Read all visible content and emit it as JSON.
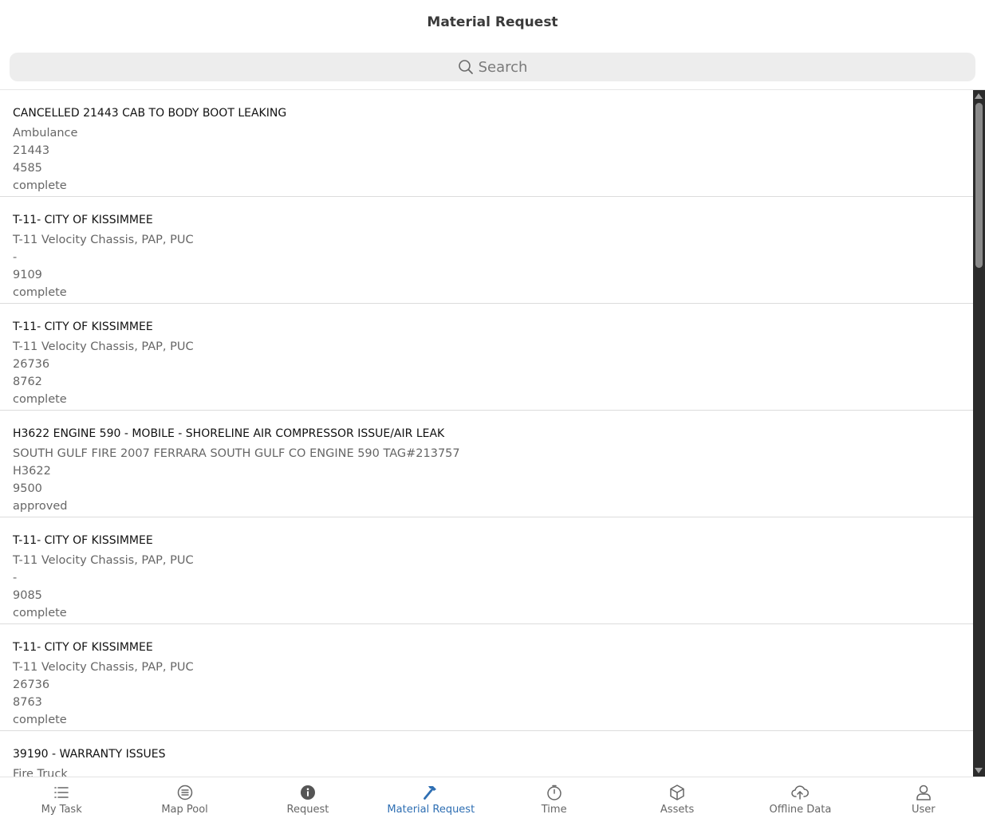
{
  "header": {
    "title": "Material Request"
  },
  "search": {
    "placeholder": "Search"
  },
  "items": [
    {
      "title": "CANCELLED 21443 CAB TO BODY BOOT LEAKING",
      "line1": "Ambulance",
      "line2": "21443",
      "line3": "4585",
      "status": "complete"
    },
    {
      "title": "T-11- CITY OF KISSIMMEE",
      "line1": "T-11 Velocity Chassis, PAP, PUC",
      "line2": "-",
      "line3": "9109",
      "status": "complete"
    },
    {
      "title": "T-11- CITY OF KISSIMMEE",
      "line1": "T-11 Velocity Chassis, PAP, PUC",
      "line2": "26736",
      "line3": "8762",
      "status": "complete"
    },
    {
      "title": "H3622 ENGINE 590 - MOBILE - SHORELINE AIR COMPRESSOR ISSUE/AIR LEAK",
      "line1": "SOUTH GULF FIRE 2007 FERRARA SOUTH GULF CO ENGINE 590 TAG#213757",
      "line2": "H3622",
      "line3": "9500",
      "status": "approved"
    },
    {
      "title": "T-11- CITY OF KISSIMMEE",
      "line1": "T-11 Velocity Chassis, PAP, PUC",
      "line2": "-",
      "line3": "9085",
      "status": "complete"
    },
    {
      "title": "T-11- CITY OF KISSIMMEE",
      "line1": "T-11 Velocity Chassis, PAP, PUC",
      "line2": "26736",
      "line3": "8763",
      "status": "complete"
    },
    {
      "title": "39190 - WARRANTY ISSUES",
      "line1": "Fire Truck",
      "line2": "",
      "line3": "",
      "status": ""
    }
  ],
  "tabs": [
    {
      "label": "My Task",
      "icon": "list-icon"
    },
    {
      "label": "Map Pool",
      "icon": "map-pool-icon"
    },
    {
      "label": "Request",
      "icon": "info-icon"
    },
    {
      "label": "Material Request",
      "icon": "hammer-icon",
      "active": true
    },
    {
      "label": "Time",
      "icon": "stopwatch-icon"
    },
    {
      "label": "Assets",
      "icon": "box-icon"
    },
    {
      "label": "Offline Data",
      "icon": "cloud-upload-icon"
    },
    {
      "label": "User",
      "icon": "user-icon"
    }
  ],
  "colors": {
    "accent": "#2f6fb3",
    "tab_inactive": "#666666",
    "search_bg": "#ededed"
  }
}
